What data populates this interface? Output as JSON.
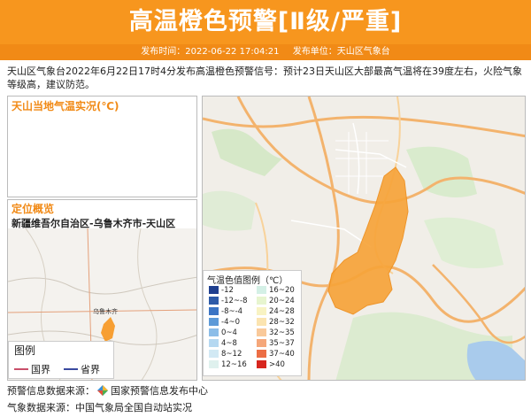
{
  "header": {
    "title": "高温橙色预警[Ⅱ级/严重]",
    "publish_time": "发布时间：2022-06-22 17:04:21",
    "publisher": "发布单位：天山区气象台",
    "accent_color": "#f7961e"
  },
  "description": "天山区气象台2022年6月22日17时4分发布高温橙色预警信号：预计23日天山区大部最高气温将在39度左右，火险气象等级高，建议防范。",
  "temp_panel": {
    "title": "天山当地气温实况(℃)"
  },
  "location_panel": {
    "title": "定位概览",
    "region": "新疆维吾尔自治区-乌鲁木齐市-天山区",
    "map_labels": [
      "乌鲁木齐"
    ],
    "legend": {
      "title": "图例",
      "items": [
        {
          "label": "国界",
          "color": "#c94f6a"
        },
        {
          "label": "省界",
          "color": "#3a4aa0"
        }
      ]
    }
  },
  "temp_legend": {
    "title": "气温色值图例（℃）",
    "items": [
      {
        "label": "-12",
        "color": "#1f3f8f"
      },
      {
        "label": "16~20",
        "color": "#d4f0e6"
      },
      {
        "label": "-12~-8",
        "color": "#2d5aa8"
      },
      {
        "label": "20~24",
        "color": "#e7f5cf"
      },
      {
        "label": "-8~-4",
        "color": "#3b74c4"
      },
      {
        "label": "24~28",
        "color": "#f8f3c3"
      },
      {
        "label": "-4~0",
        "color": "#5d9ad8"
      },
      {
        "label": "28~32",
        "color": "#fbe4b0"
      },
      {
        "label": "0~4",
        "color": "#8cbde8"
      },
      {
        "label": "32~35",
        "color": "#f9c99a"
      },
      {
        "label": "4~8",
        "color": "#b5d8f1"
      },
      {
        "label": "35~37",
        "color": "#f5a77a"
      },
      {
        "label": "8~12",
        "color": "#d2e9f4"
      },
      {
        "label": "37~40",
        "color": "#ec6e45"
      },
      {
        "label": "12~16",
        "color": "#dff1ee"
      },
      {
        "label": ">40",
        "color": "#d7261e"
      }
    ]
  },
  "footer": {
    "warning_source": "预警信息数据来源：",
    "warning_source_name": "国家预警信息发布中心",
    "weather_source": "气象数据来源：中国气象局全国自动站实况"
  }
}
